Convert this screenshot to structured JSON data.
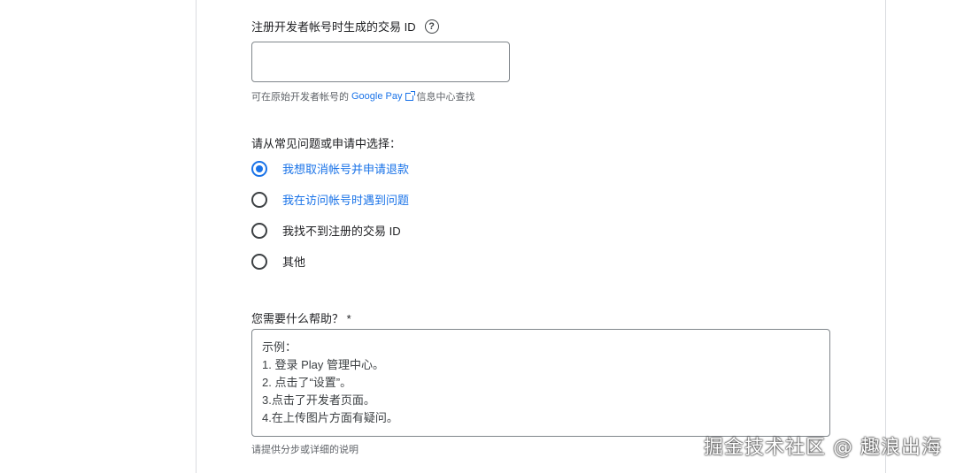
{
  "transaction_field": {
    "label": "注册开发者帐号时生成的交易 ID",
    "help_icon": "?",
    "value": "",
    "hint_prefix": "可在原始开发者帐号的",
    "hint_link": "Google Pay",
    "hint_suffix": "信息中心查找"
  },
  "question": {
    "label": "请从常见问题或申请中选择：",
    "options": [
      {
        "label": "我想取消帐号并申请退款",
        "checked": true
      },
      {
        "label": "我在访问帐号时遇到问题",
        "checked": false
      },
      {
        "label": "我找不到注册的交易 ID",
        "checked": false
      },
      {
        "label": "其他",
        "checked": false
      }
    ]
  },
  "help_field": {
    "label": "您需要什么帮助？ *",
    "placeholder": "示例：\n1. 登录 Play 管理中心。\n2. 点击了“设置”。\n3.点击了开发者页面。\n4.在上传图片方面有疑问。",
    "hint": "请提供分步或详细的说明"
  },
  "watermark": "掘金技术社区 @ 趣浪出海",
  "colors": {
    "accent": "#1a73e8",
    "text": "#202124",
    "muted": "#5f6368",
    "border": "#80868b"
  }
}
